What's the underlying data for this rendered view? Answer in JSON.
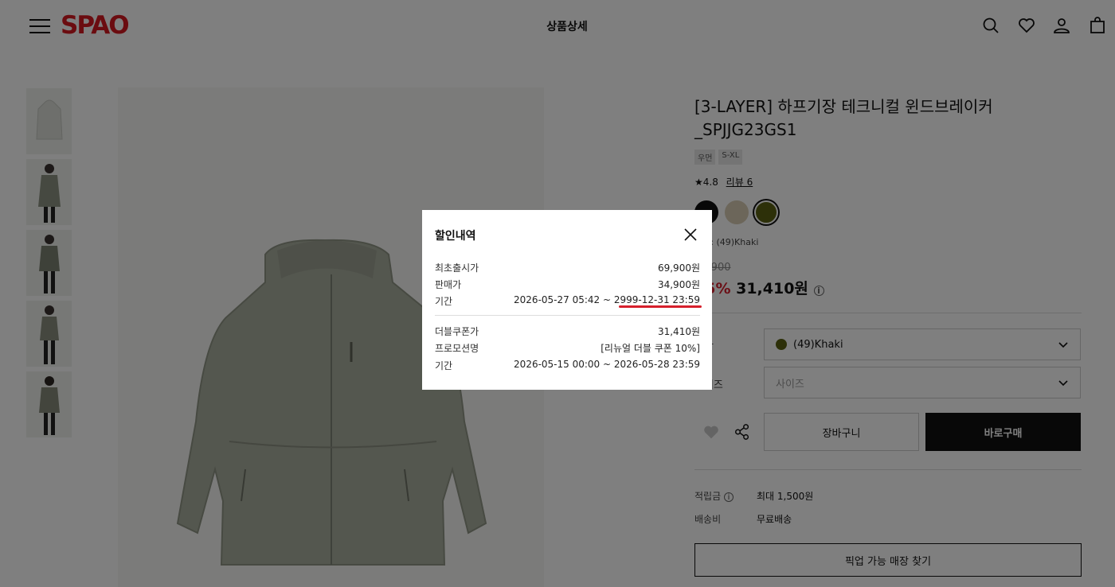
{
  "header": {
    "logo": "SPAO",
    "title": "상품상세"
  },
  "product": {
    "name": "[3-LAYER] 하프기장 테크니컬 윈드브레이커 _SPJJG23GS1",
    "tags": [
      "우먼",
      "S-XL"
    ],
    "rating": "★4.8",
    "review_link": "리뷰 6",
    "swatches": [
      {
        "name": "black",
        "color": "#111111"
      },
      {
        "name": "beige",
        "color": "#d8ccb4"
      },
      {
        "name": "khaki",
        "color": "#5a6112"
      }
    ],
    "color_name": "(49)Khaki",
    "original_price": "69,900",
    "discount_pct": "55%",
    "sale_price": "31,410원"
  },
  "options": {
    "color_label": "색상",
    "color_value": "(49)Khaki",
    "size_label": "사이즈",
    "size_placeholder": "사이즈"
  },
  "actions": {
    "cart": "장바구니",
    "buy": "바로구매",
    "pickup": "픽업 가능 매장 찾기"
  },
  "benefits": {
    "points_label": "적립금",
    "points_value": "최대 1,500원",
    "shipping_label": "배송비",
    "shipping_value": "무료배송"
  },
  "modal": {
    "title": "할인내역",
    "rows": [
      {
        "label": "최초출시가",
        "value": "69,900원"
      },
      {
        "label": "판매가",
        "value": "34,900원"
      },
      {
        "label": "기간",
        "value_start": "2026-05-27 05:42 ~ ",
        "value_end": "2999-12-31 23:59"
      },
      {
        "label": "더블쿠폰가",
        "value": "31,410원"
      },
      {
        "label": "프로모션명",
        "value": "[리뉴얼 더블 쿠폰 10%]"
      },
      {
        "label": "기간",
        "value": "2026-05-15 00:00 ~ 2026-05-28 23:59"
      }
    ]
  },
  "colors": {
    "brand": "#d71920",
    "accent_red": "#d61f2c",
    "overlay": "rgba(0,0,0,0.5)"
  }
}
